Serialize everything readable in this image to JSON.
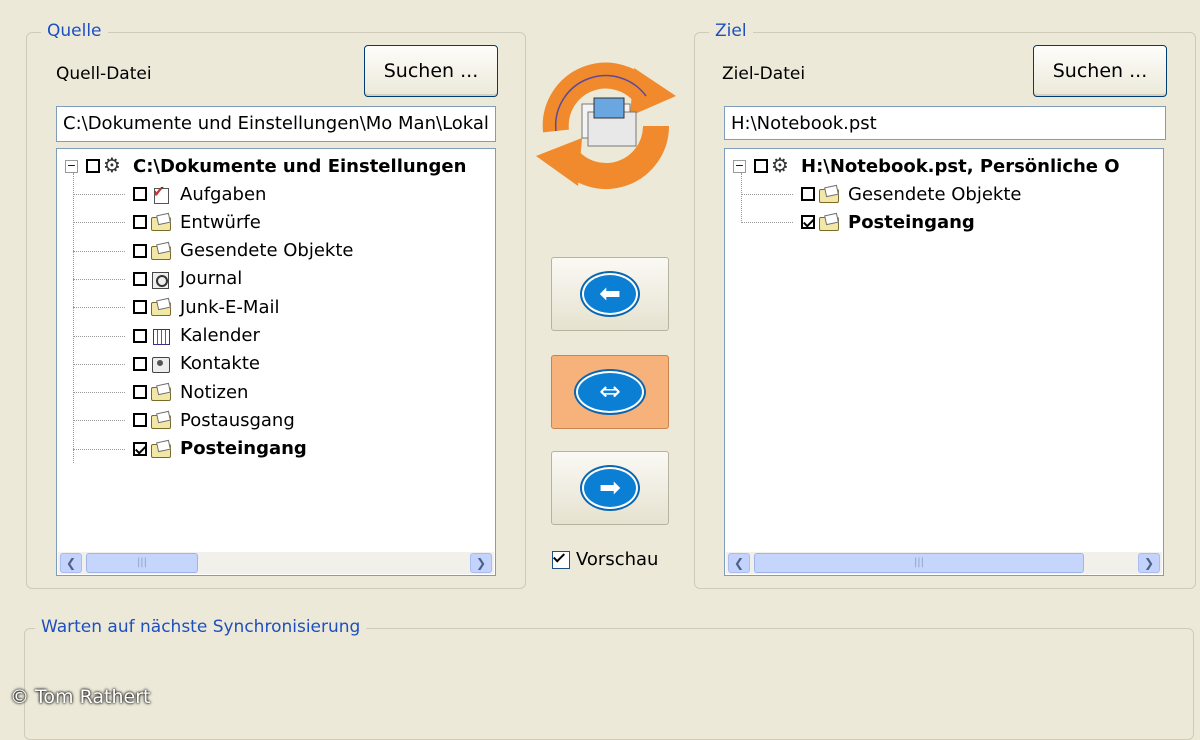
{
  "source": {
    "group_title": "Quelle",
    "file_label": "Quell-Datei",
    "search_button": "Suchen ...",
    "path_value": "C:\\Dokumente und Einstellungen\\Mo Man\\Lokal",
    "tree_root": "C:\\Dokumente und Einstellungen",
    "items": [
      {
        "label": "Aufgaben",
        "checked": false,
        "bold": false,
        "icon": "tasks-icon"
      },
      {
        "label": "Entwürfe",
        "checked": false,
        "bold": false,
        "icon": "folder-icon"
      },
      {
        "label": "Gesendete Objekte",
        "checked": false,
        "bold": false,
        "icon": "folder-icon"
      },
      {
        "label": "Journal",
        "checked": false,
        "bold": false,
        "icon": "journal-icon"
      },
      {
        "label": "Junk-E-Mail",
        "checked": false,
        "bold": false,
        "icon": "folder-icon"
      },
      {
        "label": "Kalender",
        "checked": false,
        "bold": false,
        "icon": "calendar-icon"
      },
      {
        "label": "Kontakte",
        "checked": false,
        "bold": false,
        "icon": "contacts-icon"
      },
      {
        "label": "Notizen",
        "checked": false,
        "bold": false,
        "icon": "notes-icon"
      },
      {
        "label": "Postausgang",
        "checked": false,
        "bold": false,
        "icon": "folder-icon"
      },
      {
        "label": "Posteingang",
        "checked": true,
        "bold": true,
        "icon": "inbox-icon"
      }
    ]
  },
  "target": {
    "group_title": "Ziel",
    "file_label": "Ziel-Datei",
    "search_button": "Suchen ...",
    "path_value": "H:\\Notebook.pst",
    "tree_root": "H:\\Notebook.pst, Persönliche O",
    "items": [
      {
        "label": "Gesendete Objekte",
        "checked": false,
        "bold": false,
        "icon": "folder-icon"
      },
      {
        "label": "Posteingang",
        "checked": true,
        "bold": true,
        "icon": "inbox-icon"
      }
    ]
  },
  "center": {
    "preview_label": "Vorschau",
    "preview_checked": true
  },
  "status": {
    "group_title": "Warten auf nächste Synchronisierung"
  },
  "copyright": "© Tom Rathert",
  "colors": {
    "window_bg": "#ece9d8",
    "group_title": "#1d4fc0",
    "sync_orange": "#f08a2c",
    "arrow_blue": "#0b7fd4",
    "active_button": "#f7b27b"
  }
}
